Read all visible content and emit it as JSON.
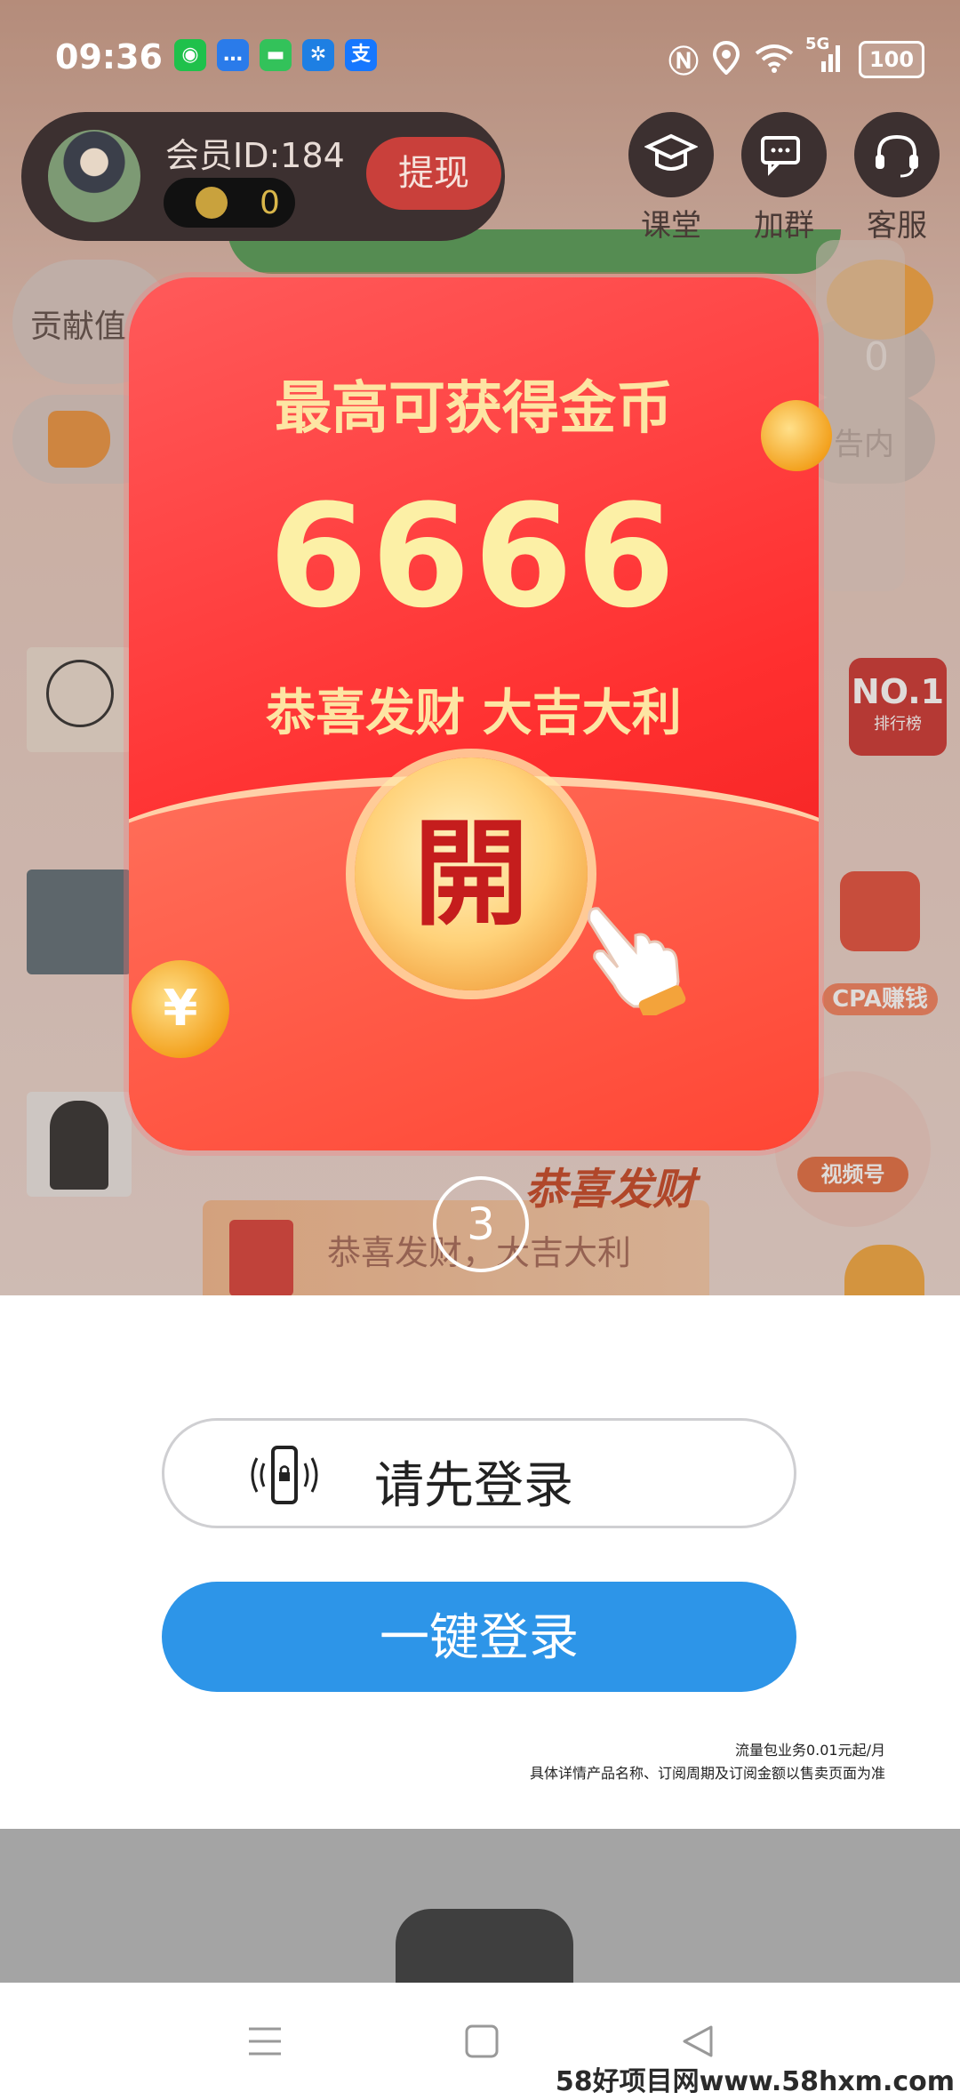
{
  "status_bar": {
    "time": "09:36",
    "network": "5G",
    "battery": "100"
  },
  "header": {
    "member_id": "会员ID:184",
    "coin_balance": "0",
    "withdraw_label": "提现",
    "buttons": [
      {
        "label": "课堂",
        "icon": "graduation-cap-icon"
      },
      {
        "label": "加群",
        "icon": "chat-bubbles-icon"
      },
      {
        "label": "客服",
        "icon": "headset-icon"
      }
    ]
  },
  "background": {
    "contribution_label": "贡献值",
    "right_value": "0",
    "right_text": "告内",
    "rank_label": "NO.1",
    "rank_sub": "排行榜",
    "cpa_label": "CPA赚钱",
    "video_label": "视频号",
    "banner_text": "恭喜发财，大吉大利",
    "congrats_deco": "恭喜发财"
  },
  "envelope": {
    "title": "最高可获得金币",
    "amount": "6666",
    "subtitle": "恭喜发财 大吉大利",
    "open_label": "開"
  },
  "countdown": "3",
  "login": {
    "hint": "请先登录",
    "button": "一键登录",
    "fine_print_1": "流量包业务0.01元起/月",
    "fine_print_2": "具体详情产品名称、订阅周期及订阅金额以售卖页面为准"
  },
  "watermark": "58好项目网www.58hxm.com",
  "colors": {
    "envelope_red": "#ff3a3a",
    "gold_text": "#fde5a3",
    "login_blue": "#2d95e8"
  }
}
